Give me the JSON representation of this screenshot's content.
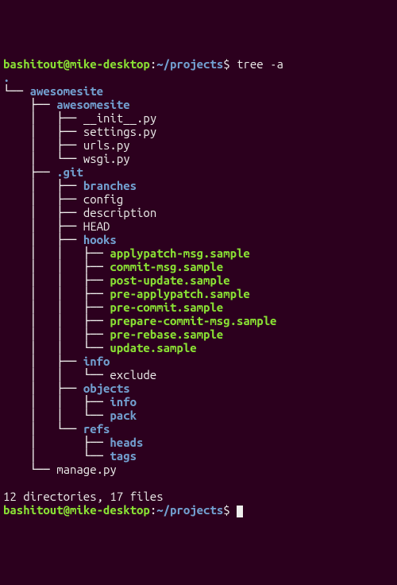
{
  "prompt": {
    "user": "bashitout",
    "at": "@",
    "host": "mike-desktop",
    "colon": ":",
    "path": "~/projects",
    "dollar": "$",
    "space": " "
  },
  "cmd": "tree -a",
  "root": ".",
  "summary": "12 directories, 17 files",
  "nodes": [
    {
      "i": "└── ",
      "t": "awesomesite",
      "c": "dir"
    },
    {
      "i": "    ├── ",
      "t": "awesomesite",
      "c": "dir"
    },
    {
      "i": "    │   ├── ",
      "t": "__init__.py",
      "c": "file"
    },
    {
      "i": "    │   ├── ",
      "t": "settings.py",
      "c": "file"
    },
    {
      "i": "    │   ├── ",
      "t": "urls.py",
      "c": "file"
    },
    {
      "i": "    │   └── ",
      "t": "wsgi.py",
      "c": "file"
    },
    {
      "i": "    ├── ",
      "t": ".git",
      "c": "dir"
    },
    {
      "i": "    │   ├── ",
      "t": "branches",
      "c": "dir"
    },
    {
      "i": "    │   ├── ",
      "t": "config",
      "c": "file"
    },
    {
      "i": "    │   ├── ",
      "t": "description",
      "c": "file"
    },
    {
      "i": "    │   ├── ",
      "t": "HEAD",
      "c": "file"
    },
    {
      "i": "    │   ├── ",
      "t": "hooks",
      "c": "dir"
    },
    {
      "i": "    │   │   ├── ",
      "t": "applypatch-msg.sample",
      "c": "exec"
    },
    {
      "i": "    │   │   ├── ",
      "t": "commit-msg.sample",
      "c": "exec"
    },
    {
      "i": "    │   │   ├── ",
      "t": "post-update.sample",
      "c": "exec"
    },
    {
      "i": "    │   │   ├── ",
      "t": "pre-applypatch.sample",
      "c": "exec"
    },
    {
      "i": "    │   │   ├── ",
      "t": "pre-commit.sample",
      "c": "exec"
    },
    {
      "i": "    │   │   ├── ",
      "t": "prepare-commit-msg.sample",
      "c": "exec"
    },
    {
      "i": "    │   │   ├── ",
      "t": "pre-rebase.sample",
      "c": "exec"
    },
    {
      "i": "    │   │   └── ",
      "t": "update.sample",
      "c": "exec"
    },
    {
      "i": "    │   ├── ",
      "t": "info",
      "c": "dir"
    },
    {
      "i": "    │   │   └── ",
      "t": "exclude",
      "c": "file"
    },
    {
      "i": "    │   ├── ",
      "t": "objects",
      "c": "dir"
    },
    {
      "i": "    │   │   ├── ",
      "t": "info",
      "c": "dir"
    },
    {
      "i": "    │   │   └── ",
      "t": "pack",
      "c": "dir"
    },
    {
      "i": "    │   └── ",
      "t": "refs",
      "c": "dir"
    },
    {
      "i": "    │       ├── ",
      "t": "heads",
      "c": "dir"
    },
    {
      "i": "    │       └── ",
      "t": "tags",
      "c": "dir"
    },
    {
      "i": "    └── ",
      "t": "manage.py",
      "c": "file"
    }
  ]
}
